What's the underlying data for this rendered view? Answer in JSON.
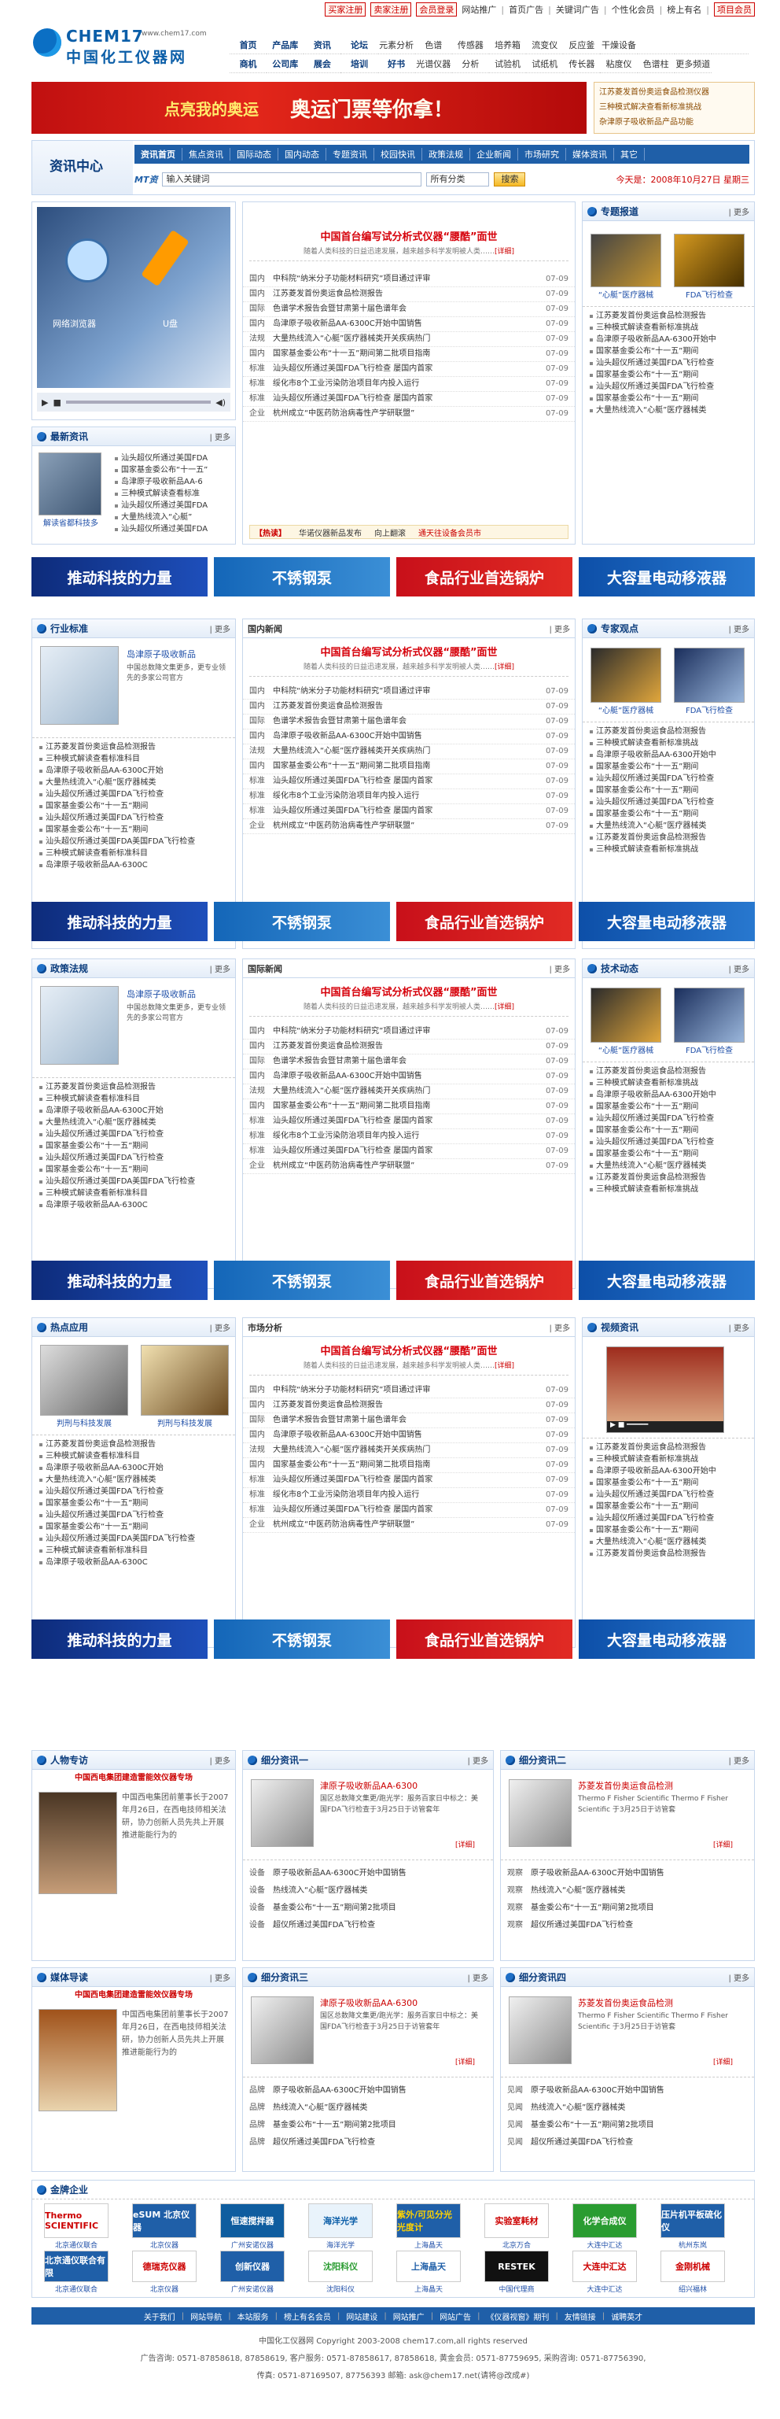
{
  "topbar": {
    "links": [
      "买家注册",
      "卖家注册",
      "会员登录",
      "网站推广",
      "首页广告",
      "关键词广告",
      "个性化会员",
      "榜上有名",
      "项目会员"
    ]
  },
  "header": {
    "logo_line1": "CHEM17",
    "logo_line2": "中国化工仪器网",
    "logo_tag": "www.chem17.com",
    "nav": [
      "首页",
      "产品库",
      "资讯",
      "论坛",
      "元素分析",
      "色谱",
      "传感器",
      "培养箱",
      "流变仪",
      "反应釜",
      "干燥设备",
      "商机",
      "公司库",
      "展会",
      "培训",
      "好书",
      "光谱仪器",
      "分析",
      "试验机",
      "试纸机",
      "传长器",
      "粘度仪",
      "色谱柱",
      "更多频道"
    ]
  },
  "banner": {
    "text_left": "点亮我的奥运",
    "text_main": "奥运门票等你拿！",
    "right": [
      "江苏菱发首份奥运食品检测仪器",
      "三种模式解决查看新标准挑战",
      "杂津原子吸收新品产品功能"
    ]
  },
  "news_center": {
    "title": "资讯中心",
    "tabs": [
      "资讯首页",
      "焦点资讯",
      "国际动态",
      "国内动态",
      "专题资讯",
      "校园快讯",
      "政策法规",
      "企业新闻",
      "市场研究",
      "媒体资讯",
      "其它"
    ],
    "search_label": "MT资",
    "search_placeholder": "输入关键词",
    "search_scope": "所有分类",
    "search_button": "搜索",
    "date": "今天是：2008年10月27日 星期三"
  },
  "slider": {
    "items": [
      "网络浏览器",
      "U盘"
    ]
  },
  "headline": {
    "title": "中国首台编写试分析式仪器“腰酷”面世",
    "sub": "随着人类科技的日益迅速发展，越来越多科学发明被人类……",
    "detail": "[详细]"
  },
  "news_rows": [
    {
      "c": "国内",
      "t": "中科院“纳米分子功能材料研究”项目通过评审",
      "d": "07-09"
    },
    {
      "c": "国内",
      "t": "江苏菱发首份奥运食品检测报告",
      "d": "07-09"
    },
    {
      "c": "国际",
      "t": "色谱学术报告会暨甘肃第十届色谱年会",
      "d": "07-09"
    },
    {
      "c": "国内",
      "t": "岛津原子吸收新品AA-6300C开始中国销售",
      "d": "07-09"
    },
    {
      "c": "法规",
      "t": "大量热线流入“心艇”医疗器械类开关疾病热门",
      "d": "07-09"
    },
    {
      "c": "国内",
      "t": "国家基金委公布“十一五”期间第二批项目指南",
      "d": "07-09"
    },
    {
      "c": "标准",
      "t": "汕头超仪所通过美国FDA飞行检查  屡国内首家",
      "d": "07-09"
    },
    {
      "c": "标准",
      "t": "绥化市8个工业污染防治项目年内投入运行",
      "d": "07-09"
    },
    {
      "c": "标准",
      "t": "汕头超仪所通过美国FDA飞行检查 屡国内首家",
      "d": "07-09"
    },
    {
      "c": "企业",
      "t": "杭州成立“中医药防治病毒性产学研联盟”",
      "d": "07-09"
    }
  ],
  "hot_bar": {
    "label": "【热读】",
    "items": [
      "华诺仪器新品发布",
      "向上翻滚",
      "通天往设备会员市"
    ]
  },
  "latest": {
    "title": "最新资讯",
    "cap": "解读省都科技多",
    "items": [
      "汕头超仪所通过美国FDA",
      "国家基金委公布“十一五”",
      "岛津原子吸收新品AA-6",
      "三种模式解读查看标准",
      "汕头超仪所通过美国FDA",
      "大量热线流入“心艇”",
      "汕头超仪所通过美国FDA"
    ]
  },
  "special": {
    "title": "专题报道",
    "caps": [
      "“心艇”医疗器械",
      "FDA飞行检查"
    ],
    "items": [
      "江苏菱发首份奥运食品检测报告",
      "三种模式解读查看新标准挑战",
      "岛津原子吸收新品AA-6300开始中",
      "国家基金委公布“十一五”期间",
      "汕头超仪所通过美国FDA飞行检查",
      "国家基金委公布“十一五”期间",
      "汕头超仪所通过美国FDA飞行检查",
      "国家基金委公布“十一五”期间",
      "大量热线流入“心艇”医疗器械类"
    ]
  },
  "ads": {
    "a": "推动科技的力量",
    "b": "不锈钢泵",
    "c": "食品行业首选锅炉",
    "d": "大容量电动移液器"
  },
  "sections": [
    {
      "left": "行业标准",
      "mid": "国内新闻",
      "right": "专家观点",
      "lcap": "岛津原子吸收新品",
      "ldesc": "中国总数降文集更多，更专业领先的多家公司官方",
      "rcaps": [
        "“心艇”医疗器械",
        "FDA飞行检查"
      ]
    },
    {
      "left": "政策法规",
      "mid": "国际新闻",
      "right": "技术动态",
      "lcap": "岛津原子吸收新品",
      "ldesc": "中国总数降文集更多，更专业领先的多家公司官方",
      "rcaps": [
        "“心艇”医疗器械",
        "FDA飞行检查"
      ]
    },
    {
      "left": "热点应用",
      "mid": "市场分析",
      "right": "视频资讯",
      "lcap": "判刑与科技发展",
      "ldesc": "",
      "rcaps": []
    }
  ],
  "side_list": [
    "江苏菱发首份奥运食品检测报告",
    "三种模式解读查看标准科目",
    "岛津原子吸收新品AA-6300C开始",
    "大量热线流入“心艇”医疗器械类",
    "汕头超仪所通过美国FDA飞行检查",
    "国家基金委公布“十一五”期间",
    "汕头超仪所通过美国FDA飞行检查",
    "国家基金委公布“十一五”期间",
    "汕头超仪所通过美国FDA美国FDA飞行检查",
    "三种模式解读查看新标准科目",
    "岛津原子吸收新品AA-6300C"
  ],
  "bottom": {
    "people": {
      "title": "人物专访",
      "sub": "中国西电集团建造雷能效仪器专场",
      "text": "中国西电集团前董事长于2007年月26日，在西电技师相关法研，协力创新人员先共上开展推进能能行为的"
    },
    "media": {
      "title": "媒体导读",
      "sub": "中国西电集团建造雷能效仪器专场",
      "text": "中国西电集团前董事长于2007年月26日，在西电技师相关法研，协力创新人员先共上开展推进能能行为的"
    },
    "s1": {
      "title": "细分资讯一",
      "head": "津原子吸收新品AA-6300",
      "body": "国区总数降文集更/跑光学：服务百家日中标之：美国FDA飞行检查于3月25日于访管套年",
      "detail": "[详细]",
      "rows": [
        {
          "c": "设备",
          "t": "原子吸收新品AA-6300C开始中国销售"
        },
        {
          "c": "设备",
          "t": "热线流入“心艇”医疗器械类"
        },
        {
          "c": "设备",
          "t": "基金委公布“十一五”期间第2批项目"
        },
        {
          "c": "设备",
          "t": "超仪所通过美国FDA飞行检查"
        }
      ]
    },
    "s2": {
      "title": "细分资讯二",
      "head": "苏菱发首份奥运食品检测",
      "body": "Thermo F Fisher Scientific Thermo F Fisher Scientific 于3月25日于访管套",
      "detail": "[详细]",
      "rows": [
        {
          "c": "观察",
          "t": "原子吸收新品AA-6300C开始中国销售"
        },
        {
          "c": "观察",
          "t": "热线流入“心艇”医疗器械类"
        },
        {
          "c": "观察",
          "t": "基金委公布“十一五”期间第2批项目"
        },
        {
          "c": "观察",
          "t": "超仪所通过美国FDA飞行检查"
        }
      ]
    },
    "s3": {
      "title": "细分资讯三",
      "head": "津原子吸收新品AA-6300",
      "body": "国区总数降文集更/跑光学：服务百家日中标之：美国FDA飞行检查于3月25日于访管套年",
      "detail": "[详细]",
      "rows": [
        {
          "c": "品牌",
          "t": "原子吸收新品AA-6300C开始中国销售"
        },
        {
          "c": "品牌",
          "t": "热线流入“心艇”医疗器械类"
        },
        {
          "c": "品牌",
          "t": "基金委公布“十一五”期间第2批项目"
        },
        {
          "c": "品牌",
          "t": "超仪所通过美国FDA飞行检查"
        }
      ]
    },
    "s4": {
      "title": "细分资讯四",
      "head": "苏菱发首份奥运食品检测",
      "body": "Thermo F Fisher Scientific Thermo F Fisher Scientific 于3月25日于访管套",
      "detail": "[详细]",
      "rows": [
        {
          "c": "见闻",
          "t": "原子吸收新品AA-6300C开始中国销售"
        },
        {
          "c": "见闻",
          "t": "热线流入“心艇”医疗器械类"
        },
        {
          "c": "见闻",
          "t": "基金委公布“十一五”期间第2批项目"
        },
        {
          "c": "见闻",
          "t": "超仪所通过美国FDA飞行检查"
        }
      ]
    }
  },
  "gold": {
    "title": "金牌企业",
    "row1": [
      "Thermo SCIENTIFIC",
      "eSUM 北京仪器",
      "恒速搅拌器",
      "海洋光学",
      "紫外/可见分光光度计",
      "实验室耗材",
      "化学合成仪",
      "压片机平板硫化仪"
    ],
    "cap1": [
      "北京通仪联合",
      "北京仪器",
      "广州安诺仪器",
      "海洋光学",
      "上海晶天",
      "北京万合",
      "大连中汇达",
      "杭州东岚"
    ],
    "row2": [
      "北京通仪联合有限",
      "德瑞克仪器",
      "创新仪器",
      "沈阳科仪",
      "上海晶天",
      "RESTEK",
      "大连中汇达",
      "金刚机械"
    ],
    "cap2": [
      "北京通仪联合",
      "北京仪器",
      "广州安诺仪器",
      "沈阳科仪",
      "上海晶天",
      "中国代理商",
      "大连中汇达",
      "绍兴福林"
    ]
  },
  "footer": {
    "nav": [
      "关于我们",
      "网站导航",
      "本站服务",
      "榜上有名会员",
      "网站建设",
      "网站推广",
      "网站广告",
      "《仪器视窗》期刊",
      "友情链接",
      "诚聘英才"
    ],
    "copyright": "中国化工仪器网    Copyright 2003-2008 chem17.com,all rights reserved",
    "line1": "广告咨询: 0571-87858618, 87858619, 客户服务: 0571-87858617, 87858618, 黄金会员: 0571-87759695, 采购咨询: 0571-87756390,",
    "line2": "传真: 0571-87169507, 87756393 邮箱: ask@chem17.net(请将@改成#)"
  }
}
